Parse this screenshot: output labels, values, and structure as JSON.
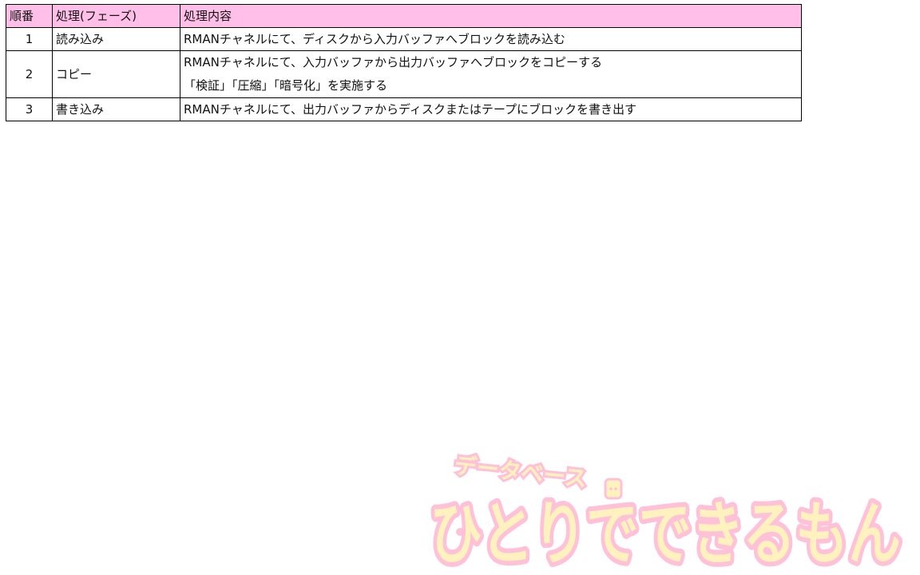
{
  "table": {
    "headers": [
      "順番",
      "処理(フェーズ)",
      "処理内容"
    ],
    "rows": [
      {
        "no": "1",
        "phase": "読み込み",
        "lines": [
          "RMANチャネルにて、ディスクから入力バッファへブロックを読み込む"
        ]
      },
      {
        "no": "2",
        "phase": "コピー",
        "lines": [
          "RMANチャネルにて、入力バッファから出力バッファへブロックをコピーする",
          "「検証」「圧縮」「暗号化」を実施する"
        ]
      },
      {
        "no": "3",
        "phase": "書き込み",
        "lines": [
          "RMANチャネルにて、出力バッファからディスクまたはテープにブロックを書き出す"
        ]
      }
    ]
  },
  "watermark": {
    "top_text": "データベース",
    "main_text": "ひとりでできるもん",
    "colors": {
      "fill": "#ffe88a",
      "outline": "#ff8fb8",
      "header_bg": "#ffbfe8"
    }
  }
}
